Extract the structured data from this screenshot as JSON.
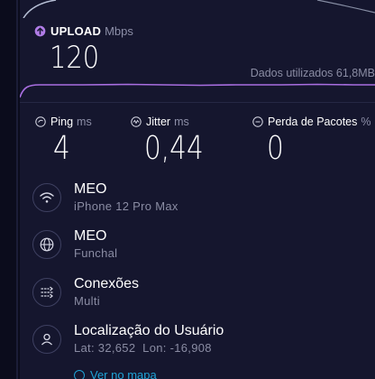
{
  "upload": {
    "title": "UPLOAD",
    "unit": "Mbps",
    "value": "120",
    "data_used": "Dados utilizados 61,8MB"
  },
  "metrics": {
    "ping": {
      "title": "Ping",
      "unit": "ms",
      "value": "4"
    },
    "jitter": {
      "title": "Jitter",
      "unit": "ms",
      "value": "0,44"
    },
    "loss": {
      "title": "Perda de Pacotes",
      "unit": "%",
      "value": "0"
    }
  },
  "info": [
    {
      "main": "MEO",
      "sub": "iPhone 12 Pro Max",
      "icon": "wifi-icon"
    },
    {
      "main": "MEO",
      "sub": "Funchal",
      "icon": "globe-icon"
    },
    {
      "main": "Conexões",
      "sub": "Multi",
      "icon": "connections-icon"
    },
    {
      "main": "Localização do Usuário",
      "sub": "Lat: 32,652  Lon: -16,908",
      "icon": "user-icon"
    }
  ],
  "bottom_link": "Ver no mapa",
  "colors": {
    "background": "#15162e",
    "upload_accent": "#b07ce6",
    "link": "#1fa3d6"
  }
}
